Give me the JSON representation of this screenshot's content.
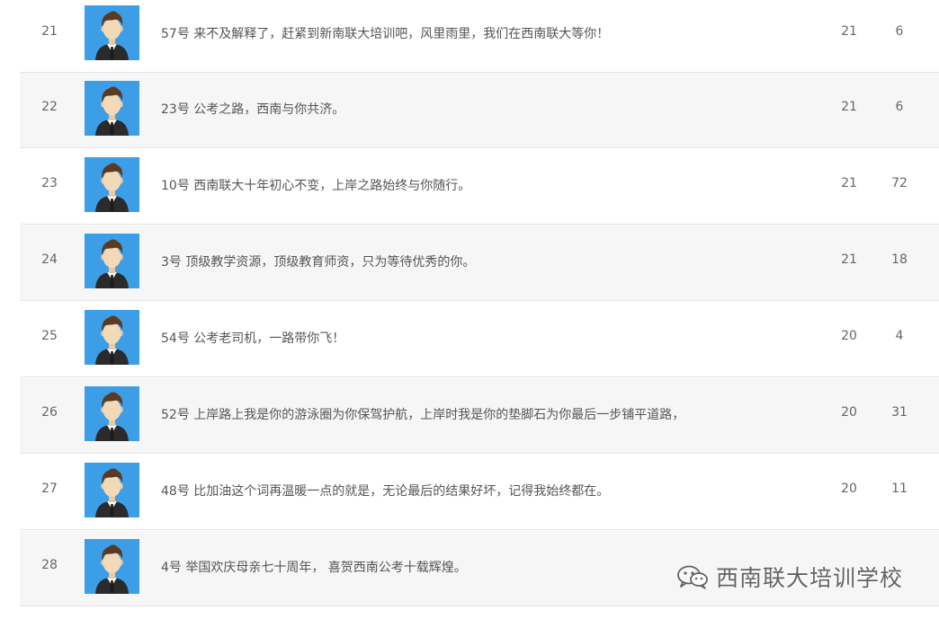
{
  "rows": [
    {
      "rank": "21",
      "message": "57号 来不及解释了，赶紧到新南联大培训吧，风里雨里，我们在西南联大等你！",
      "v1": "21",
      "v2": "6"
    },
    {
      "rank": "22",
      "message": "23号 公考之路，西南与你共济。",
      "v1": "21",
      "v2": "6"
    },
    {
      "rank": "23",
      "message": "10号 西南联大十年初心不变，上岸之路始终与你随行。",
      "v1": "21",
      "v2": "72"
    },
    {
      "rank": "24",
      "message": "3号 顶级教学资源，顶级教育师资，只为等待优秀的你。",
      "v1": "21",
      "v2": "18"
    },
    {
      "rank": "25",
      "message": "54号 公考老司机，一路带你飞！",
      "v1": "20",
      "v2": "4"
    },
    {
      "rank": "26",
      "message": "52号 上岸路上我是你的游泳圈为你保驾护航，上岸时我是你的垫脚石为你最后一步铺平道路，",
      "v1": "20",
      "v2": "31"
    },
    {
      "rank": "27",
      "message": "48号 比加油这个词再温暖一点的就是，无论最后的结果好坏，记得我始终都在。",
      "v1": "20",
      "v2": "11"
    },
    {
      "rank": "28",
      "message": "4号 举国欢庆母亲七十周年， 喜贺西南公考十载辉煌。",
      "v1": "",
      "v2": ""
    }
  ],
  "avatar_icon": "user-avatar-icon",
  "watermark": {
    "text": "西南联大培训学校",
    "icon": "wechat-icon"
  },
  "colors": {
    "row_alt_bg": "#f6f6f6",
    "row_border": "#e4e4e4",
    "avatar_bg": "#3d9ee8"
  }
}
